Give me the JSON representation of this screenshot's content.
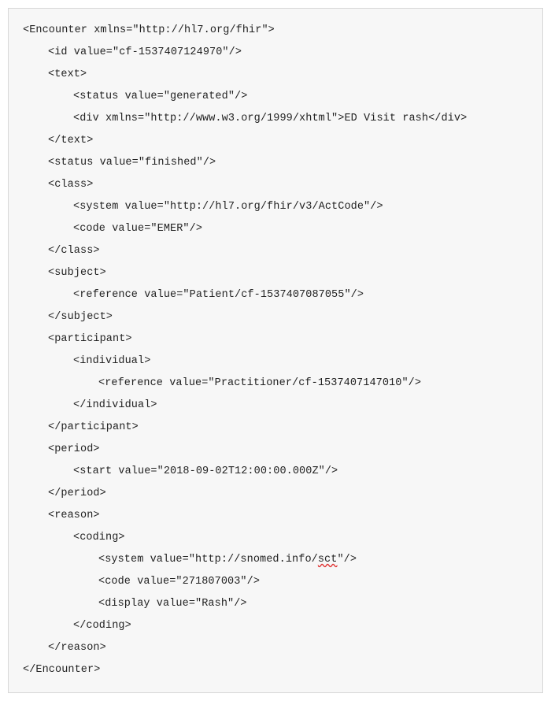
{
  "code": {
    "l1": "<Encounter xmlns=\"http://hl7.org/fhir\">",
    "l2": "<id value=\"cf-1537407124970\"/>",
    "l3": "<text>",
    "l4": "<status value=\"generated\"/>",
    "l5": "<div xmlns=\"http://www.w3.org/1999/xhtml\">ED Visit rash</div>",
    "l6": "</text>",
    "l7": "<status value=\"finished\"/>",
    "l8": "<class>",
    "l9": "<system value=\"http://hl7.org/fhir/v3/ActCode\"/>",
    "l10": "<code value=\"EMER\"/>",
    "l11": "</class>",
    "l12": "<subject>",
    "l13": "<reference value=\"Patient/cf-1537407087055\"/>",
    "l14": "</subject>",
    "l15": "<participant>",
    "l16": "<individual>",
    "l17": "<reference value=\"Practitioner/cf-1537407147010\"/>",
    "l18": "</individual>",
    "l19": "</participant>",
    "l20": "<period>",
    "l21": "<start value=\"2018-09-02T12:00:00.000Z\"/>",
    "l22": "</period>",
    "l23": "<reason>",
    "l24": "<coding>",
    "l25a": "<system value=\"http://snomed.info/",
    "l25b": "sct",
    "l25c": "\"/>",
    "l26": "<code value=\"271807003\"/>",
    "l27": "<display value=\"Rash\"/>",
    "l28": "</coding>",
    "l29": "</reason>",
    "l30": "</Encounter>"
  }
}
